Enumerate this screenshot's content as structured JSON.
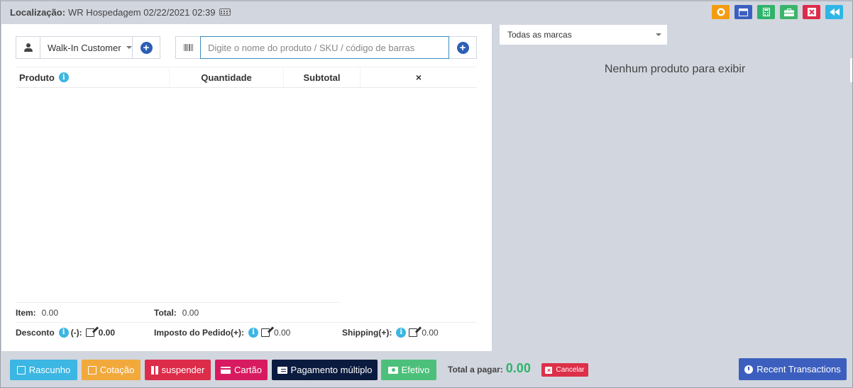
{
  "header": {
    "location_label": "Localização:",
    "location_value": "WR Hospedagem 02/22/2021 02:39",
    "icons": [
      "coin-icon",
      "window-icon",
      "calculator-icon",
      "briefcase-icon",
      "close-icon",
      "backward-icon"
    ]
  },
  "customer": {
    "selected": "Walk-In Customer"
  },
  "product_search": {
    "placeholder": "Digite o nome do produto / SKU / código de barras"
  },
  "cart_table": {
    "columns": [
      "Produto",
      "Quantidade",
      "Subtotal",
      "×"
    ]
  },
  "totals": {
    "item_label": "Item:",
    "item_value": "0.00",
    "total_label": "Total:",
    "total_value": "0.00",
    "discount_label": "Desconto",
    "discount_suffix": "(-):",
    "discount_value": "0.00",
    "tax_label": "Imposto do Pedido(+):",
    "tax_value": "0.00",
    "shipping_label": "Shipping(+):",
    "shipping_value": "0.00"
  },
  "brands": {
    "selected": "Todas as marcas"
  },
  "products": {
    "empty_message": "Nenhum produto para exibir"
  },
  "footer": {
    "draft": "Rascunho",
    "quotation": "Cotação",
    "suspend": "suspender",
    "card": "Cartão",
    "multiple_payment": "Pagamento múltiplo",
    "cash": "Efetivo",
    "total_payable_label": "Total a pagar:",
    "total_payable_value": "0.00",
    "cancel": "Cancelar",
    "recent_transactions": "Recent Transactions"
  },
  "colors": {
    "primary_blue": "#3c5fbf",
    "green": "#2fb36b",
    "red": "#dd2c4a",
    "info": "#3cb6e3",
    "warning": "#f2a93b",
    "navy": "#0b1b3f"
  }
}
